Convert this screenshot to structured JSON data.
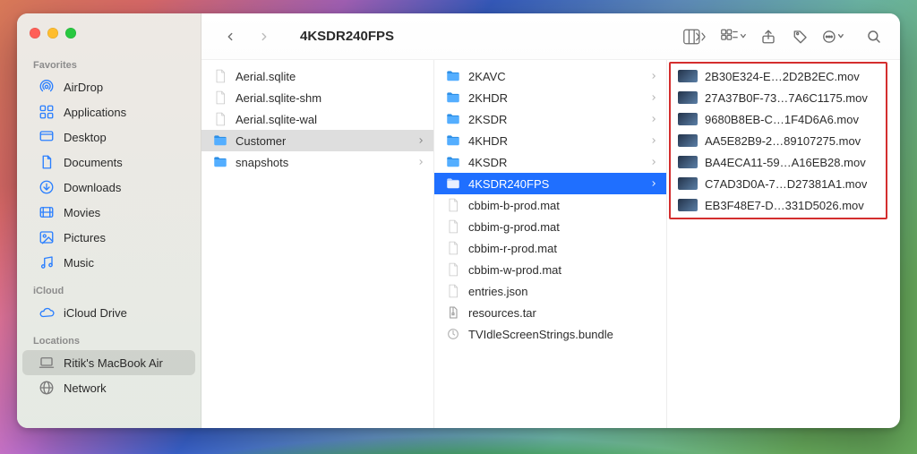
{
  "window": {
    "title": "4KSDR240FPS"
  },
  "sidebar": {
    "sections": [
      {
        "title": "Favorites",
        "items": [
          {
            "label": "AirDrop",
            "icon": "airdrop",
            "name": "sidebar-item-airdrop",
            "selected": false
          },
          {
            "label": "Applications",
            "icon": "apps",
            "name": "sidebar-item-applications",
            "selected": false
          },
          {
            "label": "Desktop",
            "icon": "desktop",
            "name": "sidebar-item-desktop",
            "selected": false
          },
          {
            "label": "Documents",
            "icon": "document",
            "name": "sidebar-item-documents",
            "selected": false
          },
          {
            "label": "Downloads",
            "icon": "download",
            "name": "sidebar-item-downloads",
            "selected": false
          },
          {
            "label": "Movies",
            "icon": "movie",
            "name": "sidebar-item-movies",
            "selected": false
          },
          {
            "label": "Pictures",
            "icon": "picture",
            "name": "sidebar-item-pictures",
            "selected": false
          },
          {
            "label": "Music",
            "icon": "music",
            "name": "sidebar-item-music",
            "selected": false
          }
        ]
      },
      {
        "title": "iCloud",
        "items": [
          {
            "label": "iCloud Drive",
            "icon": "cloud",
            "name": "sidebar-item-icloud-drive",
            "selected": false
          }
        ]
      },
      {
        "title": "Locations",
        "items": [
          {
            "label": "Ritik's MacBook Air",
            "icon": "laptop",
            "name": "sidebar-item-this-mac",
            "selected": true,
            "gray": true
          },
          {
            "label": "Network",
            "icon": "network",
            "name": "sidebar-item-network",
            "selected": false,
            "gray": true
          }
        ]
      }
    ]
  },
  "columns": {
    "c1": [
      {
        "label": "Aerial.sqlite",
        "kind": "file",
        "selected": "none"
      },
      {
        "label": "Aerial.sqlite-shm",
        "kind": "file",
        "selected": "none"
      },
      {
        "label": "Aerial.sqlite-wal",
        "kind": "file",
        "selected": "none"
      },
      {
        "label": "Customer",
        "kind": "folder",
        "selected": "gray",
        "chev": true
      },
      {
        "label": "snapshots",
        "kind": "folder",
        "selected": "none",
        "chev": true
      }
    ],
    "c2": [
      {
        "label": "2KAVC",
        "kind": "folder",
        "selected": "none",
        "chev": true
      },
      {
        "label": "2KHDR",
        "kind": "folder",
        "selected": "none",
        "chev": true
      },
      {
        "label": "2KSDR",
        "kind": "folder",
        "selected": "none",
        "chev": true
      },
      {
        "label": "4KHDR",
        "kind": "folder",
        "selected": "none",
        "chev": true
      },
      {
        "label": "4KSDR",
        "kind": "folder",
        "selected": "none",
        "chev": true
      },
      {
        "label": "4KSDR240FPS",
        "kind": "folder",
        "selected": "blue",
        "chev": true
      },
      {
        "label": "cbbim-b-prod.mat",
        "kind": "file",
        "selected": "none"
      },
      {
        "label": "cbbim-g-prod.mat",
        "kind": "file",
        "selected": "none"
      },
      {
        "label": "cbbim-r-prod.mat",
        "kind": "file",
        "selected": "none"
      },
      {
        "label": "cbbim-w-prod.mat",
        "kind": "file",
        "selected": "none"
      },
      {
        "label": "entries.json",
        "kind": "file",
        "selected": "none"
      },
      {
        "label": "resources.tar",
        "kind": "archive",
        "selected": "none"
      },
      {
        "label": "TVIdleScreenStrings.bundle",
        "kind": "bundle",
        "selected": "none"
      }
    ],
    "c3": [
      {
        "label": "2B30E324-E…2D2B2EC.mov",
        "kind": "video"
      },
      {
        "label": "27A37B0F-73…7A6C1175.mov",
        "kind": "video"
      },
      {
        "label": "9680B8EB-C…1F4D6A6.mov",
        "kind": "video"
      },
      {
        "label": "AA5E82B9-2…89107275.mov",
        "kind": "video"
      },
      {
        "label": "BA4ECA11-59…A16EB28.mov",
        "kind": "video"
      },
      {
        "label": "C7AD3D0A-7…D27381A1.mov",
        "kind": "video"
      },
      {
        "label": "EB3F48E7-D…331D5026.mov",
        "kind": "video"
      }
    ]
  }
}
